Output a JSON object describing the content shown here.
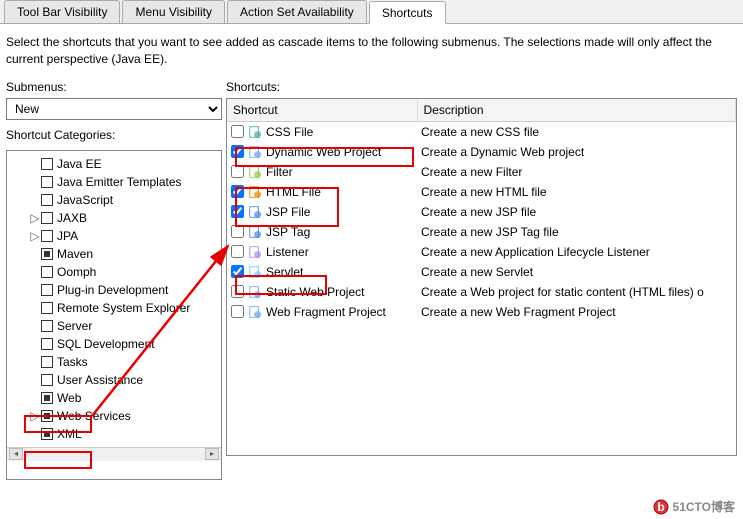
{
  "tabs": {
    "toolbar": "Tool Bar Visibility",
    "menu": "Menu Visibility",
    "actionset": "Action Set Availability",
    "shortcuts": "Shortcuts"
  },
  "description": "Select the shortcuts that you want to see added as cascade items to the following submenus.  The selections made will only affect the current perspective (Java EE).",
  "labels": {
    "submenus": "Submenus:",
    "shortcuts": "Shortcuts:",
    "categories": "Shortcut Categories:",
    "th_shortcut": "Shortcut",
    "th_description": "Description"
  },
  "combo": {
    "value": "New"
  },
  "categories": [
    {
      "twisty": "",
      "label": "Java EE",
      "checked": false
    },
    {
      "twisty": "",
      "label": "Java Emitter Templates",
      "checked": false
    },
    {
      "twisty": "",
      "label": "JavaScript",
      "checked": false
    },
    {
      "twisty": "▷",
      "label": "JAXB",
      "checked": false
    },
    {
      "twisty": "▷",
      "label": "JPA",
      "checked": false
    },
    {
      "twisty": "",
      "label": "Maven",
      "checked": true
    },
    {
      "twisty": "",
      "label": "Oomph",
      "checked": false
    },
    {
      "twisty": "",
      "label": "Plug-in Development",
      "checked": false
    },
    {
      "twisty": "",
      "label": "Remote System Explorer",
      "checked": false
    },
    {
      "twisty": "",
      "label": "Server",
      "checked": false
    },
    {
      "twisty": "",
      "label": "SQL Development",
      "checked": false
    },
    {
      "twisty": "",
      "label": "Tasks",
      "checked": false
    },
    {
      "twisty": "",
      "label": "User Assistance",
      "checked": false
    },
    {
      "twisty": "",
      "label": "Web",
      "checked": true
    },
    {
      "twisty": "▷",
      "label": "Web Services",
      "checked": true
    },
    {
      "twisty": "",
      "label": "XML",
      "checked": true
    }
  ],
  "shortcuts": [
    {
      "checked": false,
      "icon": "css",
      "label": "CSS File",
      "desc": "Create a new CSS file"
    },
    {
      "checked": true,
      "icon": "dynweb",
      "label": "Dynamic Web Project",
      "desc": "Create a Dynamic Web project"
    },
    {
      "checked": false,
      "icon": "filter",
      "label": "Filter",
      "desc": "Create a new Filter"
    },
    {
      "checked": true,
      "icon": "html",
      "label": "HTML File",
      "desc": "Create a new HTML file"
    },
    {
      "checked": true,
      "icon": "jsp",
      "label": "JSP File",
      "desc": "Create a new JSP file"
    },
    {
      "checked": false,
      "icon": "jsptag",
      "label": "JSP Tag",
      "desc": "Create a new JSP Tag file"
    },
    {
      "checked": false,
      "icon": "listener",
      "label": "Listener",
      "desc": "Create a new Application Lifecycle Listener"
    },
    {
      "checked": true,
      "icon": "servlet",
      "label": "Servlet",
      "desc": "Create a new Servlet"
    },
    {
      "checked": false,
      "icon": "staticweb",
      "label": "Static Web Project",
      "desc": "Create a Web project for static content (HTML files) o"
    },
    {
      "checked": false,
      "icon": "webfrag",
      "label": "Web Fragment Project",
      "desc": "Create a new Web Fragment Project"
    }
  ],
  "watermark": "51CTO博客"
}
